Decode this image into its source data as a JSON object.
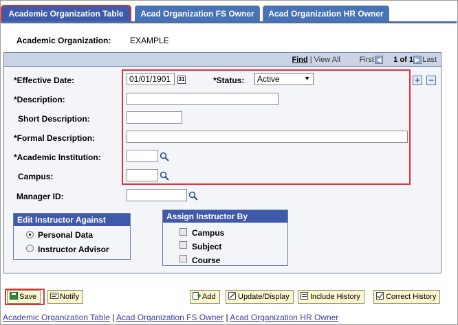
{
  "tabs": [
    {
      "label": "Academic Organization Table",
      "active": true
    },
    {
      "label": "Acad Organization FS Owner",
      "active": false
    },
    {
      "label": "Acad Organization HR Owner",
      "active": false
    }
  ],
  "header": {
    "acad_org_label": "Academic Organization:",
    "acad_org_value": "EXAMPLE"
  },
  "nav": {
    "find": "Find",
    "view_all": "View All",
    "first": "First",
    "count": "1 of 1",
    "last": "Last"
  },
  "form": {
    "effective_date_label": "*Effective Date:",
    "effective_date_value": "01/01/1901",
    "status_label": "*Status:",
    "status_value": "Active",
    "description_label": "*Description:",
    "description_value": "",
    "short_description_label": "Short Description:",
    "short_description_value": "",
    "formal_description_label": "*Formal Description:",
    "formal_description_value": "",
    "academic_institution_label": "*Academic Institution:",
    "academic_institution_value": "",
    "campus_label": "Campus:",
    "campus_value": "",
    "manager_id_label": "Manager ID:",
    "manager_id_value": ""
  },
  "edit_instructor": {
    "title": "Edit Instructor Against",
    "options": [
      "Personal Data",
      "Instructor Advisor"
    ],
    "selected": "Personal Data"
  },
  "assign_instructor": {
    "title": "Assign Instructor By",
    "options": [
      "Campus",
      "Subject",
      "Course"
    ]
  },
  "buttons": {
    "save": "Save",
    "notify": "Notify",
    "add": "Add",
    "update_display": "Update/Display",
    "include_history": "Include History",
    "correct_history": "Correct History"
  },
  "bottom_links": [
    "Academic Organization Table",
    "Acad Organization FS Owner",
    "Acad Organization HR Owner"
  ],
  "colors": {
    "tab_active": "#3f5aa8",
    "highlight_red": "#e2313b",
    "button_bg": "#fbf6cf",
    "link": "#3a3aa8"
  }
}
